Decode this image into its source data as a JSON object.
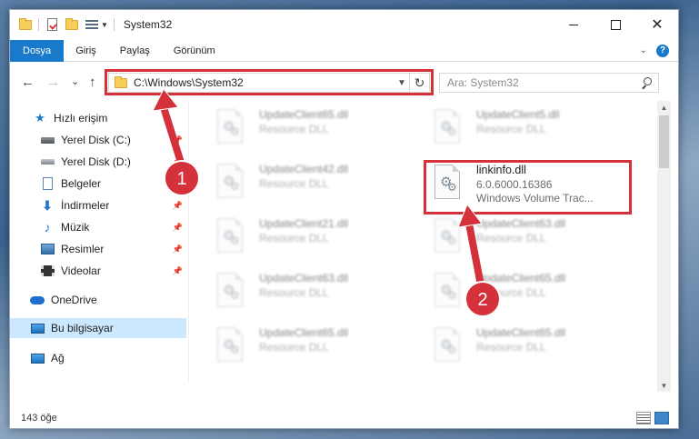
{
  "window": {
    "title": "System32",
    "controls": {
      "minimize": "",
      "maximize": "",
      "close": "✕"
    }
  },
  "ribbon": {
    "tabs": [
      {
        "label": "Dosya"
      },
      {
        "label": "Giriş"
      },
      {
        "label": "Paylaş"
      },
      {
        "label": "Görünüm"
      }
    ],
    "help": "?"
  },
  "navigation": {
    "back": "←",
    "forward": "→",
    "recent": "⌄",
    "up": "↑",
    "address": "C:\\Windows\\System32",
    "search_placeholder": "Ara: System32"
  },
  "sidebar": {
    "items": [
      {
        "label": "Hızlı erişim",
        "icon": "star-icon"
      },
      {
        "label": "Yerel Disk (C:)",
        "icon": "drive-icon",
        "pinned": true
      },
      {
        "label": "Yerel Disk (D:)",
        "icon": "drive-icon",
        "pinned": true
      },
      {
        "label": "Belgeler",
        "icon": "documents-icon",
        "pinned": true
      },
      {
        "label": "İndirmeler",
        "icon": "downloads-icon",
        "pinned": true
      },
      {
        "label": "Müzik",
        "icon": "music-icon",
        "pinned": true
      },
      {
        "label": "Resimler",
        "icon": "pictures-icon",
        "pinned": true
      },
      {
        "label": "Videolar",
        "icon": "videos-icon",
        "pinned": true
      },
      {
        "label": "OneDrive",
        "icon": "cloud-icon"
      },
      {
        "label": "Bu bilgisayar",
        "icon": "computer-icon",
        "selected": true
      },
      {
        "label": "Ağ",
        "icon": "network-icon"
      }
    ]
  },
  "files": [
    {
      "name": "UpdateClient65.dll",
      "type": "Resource DLL"
    },
    {
      "name": "UpdateClient5.dll",
      "type": "Resource DLL"
    },
    {
      "name": "UpdateClient42.dll",
      "type": "Resource DLL"
    },
    {
      "name": "linkinfo.dll",
      "version": "6.0.6000.16386",
      "type": "Windows Volume Trac..."
    },
    {
      "name": "UpdateClient21.dll",
      "type": "Resource DLL"
    },
    {
      "name": "UpdateClient63.dll",
      "type": "Resource DLL"
    },
    {
      "name": "UpdateClient63.dll",
      "type": "Resource DLL"
    },
    {
      "name": "UpdateClient65.dll",
      "type": "Resource DLL"
    },
    {
      "name": "UpdateClient65.dll",
      "type": "Resource DLL"
    },
    {
      "name": "UpdateClient65.dll",
      "type": "Resource DLL"
    }
  ],
  "status": {
    "item_count": "143 öğe"
  },
  "annotations": {
    "step1": "1",
    "step2": "2",
    "color": "#d4313a"
  }
}
